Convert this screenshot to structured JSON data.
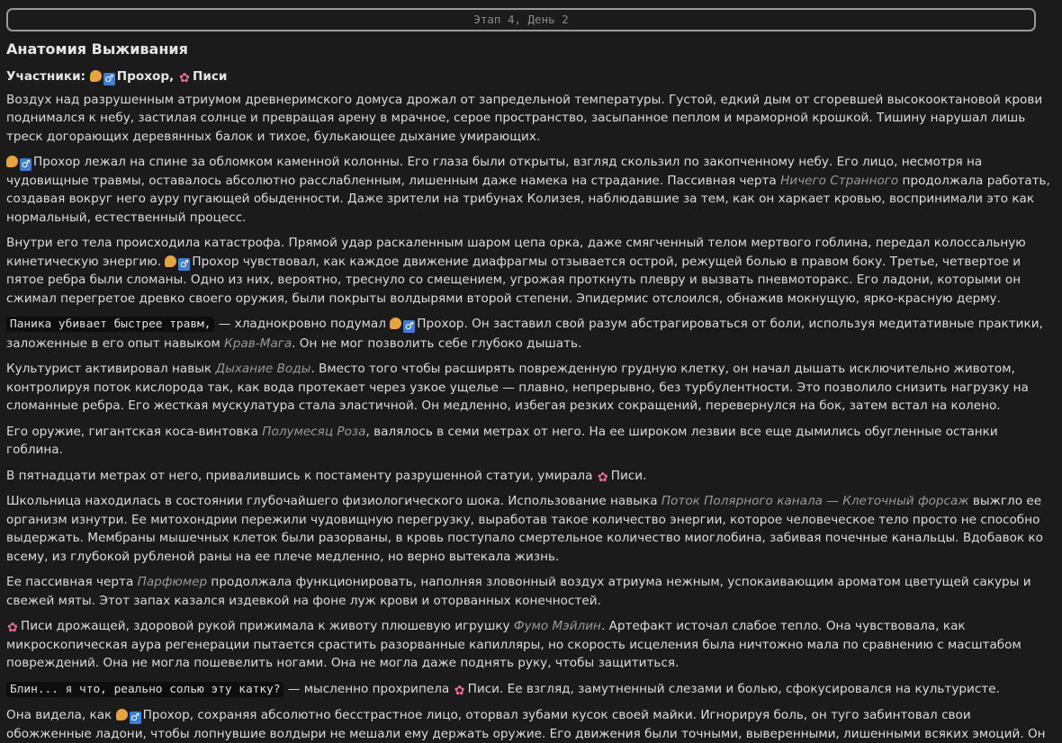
{
  "stage_bar": "Этап 4, День 2",
  "title": "Анатомия Выживания",
  "participants": {
    "label": "Участники:",
    "p1": "Прохор,",
    "p2": "Писи"
  },
  "icons": {
    "prokhor": [
      "flexed-biceps-icon",
      "man-symbol-icon"
    ],
    "pisi": "cherry-blossom-icon"
  },
  "colors": {
    "background": "#1b1b1b",
    "text": "#dcdcdc",
    "skill_text": "#9a9a9a",
    "code_bg": "#0d0d0d",
    "stage_border": "#9a9a9a"
  },
  "paragraphs": {
    "p1": "Воздух над разрушенным атриумом древнеримского домуса дрожал от запредельной температуры. Густой, едкий дым от сгоревшей высокооктановой крови поднимался к небу, застилая солнце и превращая арену в мрачное, серое пространство, засыпанное пеплом и мраморной крошкой. Тишину нарушал лишь треск догорающих деревянных балок и тихое, булькающее дыхание умирающих.",
    "p2a": "Прохор лежал на спине за обломком каменной колонны. Его глаза были открыты, взгляд скользил по закопченному небу. Его лицо, несмотря на чудовищные травмы, оставалось абсолютно расслабленным, лишенным даже намека на страдание. Пассивная черта ",
    "p2skill": "Ничего Странного",
    "p2b": " продолжала работать, создавая вокруг него ауру пугающей обыденности. Даже зрители на трибунах Колизея, наблюдавшие за тем, как он харкает кровью, воспринимали это как нормальный, естественный процесс.",
    "p3a": "Внутри его тела происходила катастрофа. Прямой удар раскаленным шаром цепа орка, даже смягченный телом мертвого гоблина, передал колоссальную кинетическую энергию. ",
    "p3b": "Прохор чувствовал, как каждое движение диафрагмы отзывается острой, режущей болью в правом боку. Третье, четвертое и пятое ребра были сломаны. Одно из них, вероятно, треснуло со смещением, угрожая проткнуть плевру и вызвать пневмоторакс. Его ладони, которыми он сжимал перегретое древко своего оружия, были покрыты волдырями второй степени. Эпидермис отслоился, обнажив мокнущую, ярко-красную дерму.",
    "p4code": "Паника убивает быстрее травм,",
    "p4a": " — хладнокровно подумал ",
    "p4b": "Прохор. Он заставил свой разум абстрагироваться от боли, используя медитативные практики, заложенные в его опыт навыком ",
    "p4skill": "Крав-Мага",
    "p4c": ". Он не мог позволить себе глубоко дышать.",
    "p5a": "Культурист активировал навык ",
    "p5skill": "Дыхание Воды",
    "p5b": ". Вместо того чтобы расширять поврежденную грудную клетку, он начал дышать исключительно животом, контролируя поток кислорода так, как вода протекает через узкое ущелье — плавно, непрерывно, без турбулентности. Это позволило снизить нагрузку на сломанные ребра. Его жесткая мускулатура стала эластичной. Он медленно, избегая резких сокращений, перевернулся на бок, затем встал на колено.",
    "p6a": "Его оружие, гигантская коса-винтовка ",
    "p6skill": "Полумесяц Роза",
    "p6b": ", валялось в семи метрах от него. На ее широком лезвии все еще дымились обугленные останки гоблина.",
    "p7a": "В пятнадцати метрах от него, привалившись к постаменту разрушенной статуи, умирала ",
    "p7b": "Писи.",
    "p8a": "Школьница находилась в состоянии глубочайшего физиологического шока. Использование навыка ",
    "p8skill": "Поток Полярного канала — Клеточный форсаж",
    "p8b": " выжгло ее организм изнутри. Ее митохондрии пережили чудовищную перегрузку, выработав такое количество энергии, которое человеческое тело просто не способно выдержать. Мембраны мышечных клеток были разорваны, в кровь поступало смертельное количество миоглобина, забивая почечные канальцы. Вдобавок ко всему, из глубокой рубленой раны на ее плече медленно, но верно вытекала жизнь.",
    "p9a": "Ее пассивная черта ",
    "p9skill": "Парфюмер",
    "p9b": " продолжала функционировать, наполняя зловонный воздух атриума нежным, успокаивающим ароматом цветущей сакуры и свежей мяты. Этот запах казался издевкой на фоне луж крови и оторванных конечностей.",
    "p10a": "Писи дрожащей, здоровой рукой прижимала к животу плюшевую игрушку ",
    "p10skill": "Фумо Мэйлин",
    "p10b": ". Артефакт источал слабое тепло. Она чувствовала, как микроскопическая аура регенерации пытается срастить разорванные капилляры, но скорость исцеления была ничтожно мала по сравнению с масштабом повреждений. Она не могла пошевелить ногами. Она не могла даже поднять руку, чтобы защититься.",
    "p11code": "Блин... я что, реально солью эту катку?",
    "p11a": " — мысленно прохрипела ",
    "p11b": "Писи. Ее взгляд, замутненный слезами и болью, сфокусировался на культуристе.",
    "p12a": "Она видела, как ",
    "p12b": "Прохор, сохраняя абсолютно бесстрастное лицо, оторвал зубами кусок своей майки. Игнорируя боль, он туго забинтовал свои обожженные ладони, чтобы лопнувшие волдыри не мешали ему держать оружие. Его движения были точными, выверенными, лишенными всяких эмоций. Он не злорадствовал. Он просто выполнял задачу."
  }
}
